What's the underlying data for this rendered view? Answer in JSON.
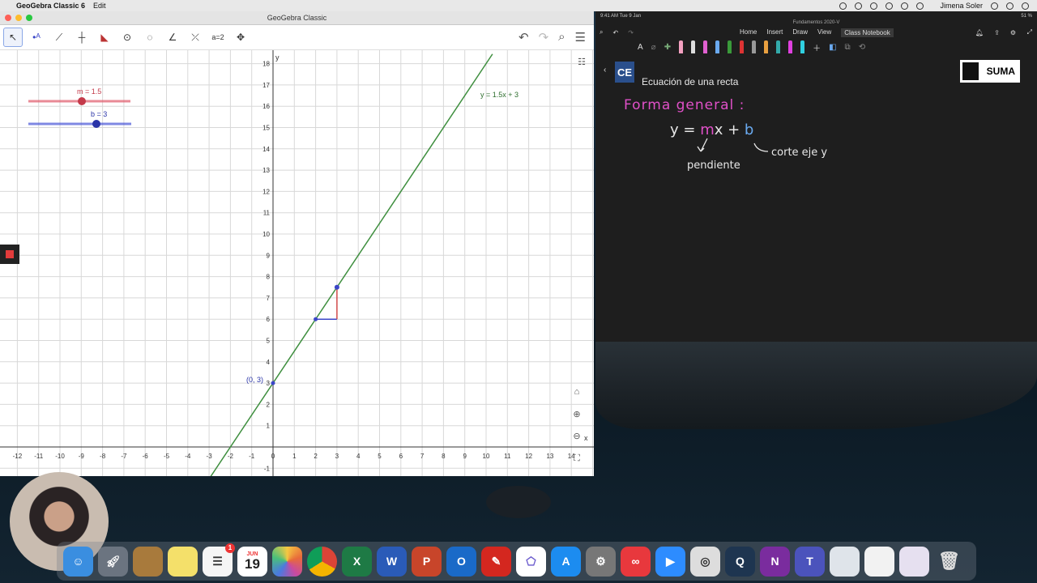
{
  "menubar": {
    "app_name": "GeoGebra Classic 6",
    "menu_edit": "Edit",
    "user": "Jimena Soler"
  },
  "geogebra": {
    "window_title": "GeoGebra Classic",
    "slider_m": "m = 1.5",
    "slider_b": "b = 3",
    "slider_m_value": 1.5,
    "slider_b_value": 3,
    "line_label": "y = 1.5x + 3",
    "point_label": "(0, 3)",
    "x_axis_label": "x",
    "y_axis_label": "y",
    "x_ticks": [
      "-12",
      "-11",
      "-10",
      "-9",
      "-8",
      "-7",
      "-6",
      "-5",
      "-4",
      "-3",
      "-2",
      "-1",
      "0",
      "1",
      "2",
      "3",
      "4",
      "5",
      "6",
      "7",
      "8",
      "9",
      "10",
      "11",
      "12",
      "13",
      "14"
    ],
    "y_ticks": [
      "-1",
      "1",
      "2",
      "3",
      "4",
      "5",
      "6",
      "7",
      "8",
      "9",
      "10",
      "11",
      "12",
      "13",
      "14",
      "15",
      "16",
      "17",
      "18"
    ],
    "colors": {
      "line": "#3f8f3f",
      "slider_m": "#e05a6a",
      "slider_b": "#4a56d8",
      "triangle_h": "#3b46c8",
      "triangle_v": "#d24a4a"
    }
  },
  "onenote": {
    "status_time": "9:41 AM  Tue 9 Jan",
    "status_battery": "51 %",
    "doc_title": "Fundamentos 2020-V",
    "tabs": [
      "Home",
      "Insert",
      "Draw",
      "View",
      "Class Notebook"
    ],
    "active_tab": "Class Notebook",
    "page_title": "Ecuación de una recta",
    "logo_text": "SUMA",
    "ce_logo": "CE",
    "handwriting": {
      "heading": "Forma general :",
      "eq_y": "y = ",
      "eq_m": "m",
      "eq_x": "x + ",
      "eq_b": "b",
      "note_slope": "pendiente",
      "note_intercept": "corte eje y"
    }
  },
  "dock": {
    "calendar_month": "JUN",
    "calendar_day": "19",
    "reminders_badge": "1",
    "apps": [
      "finder",
      "launchpad",
      "notes-book",
      "notes",
      "reminders",
      "calendar",
      "photos",
      "chrome",
      "excel",
      "word",
      "powerpoint",
      "outlook",
      "acrobat",
      "geogebra",
      "app-store",
      "system-preferences",
      "creative-cloud",
      "zoom",
      "screenshot",
      "quicktime",
      "onenote",
      "teams",
      "preview-1",
      "preview-2",
      "preview-3",
      "trash"
    ]
  }
}
